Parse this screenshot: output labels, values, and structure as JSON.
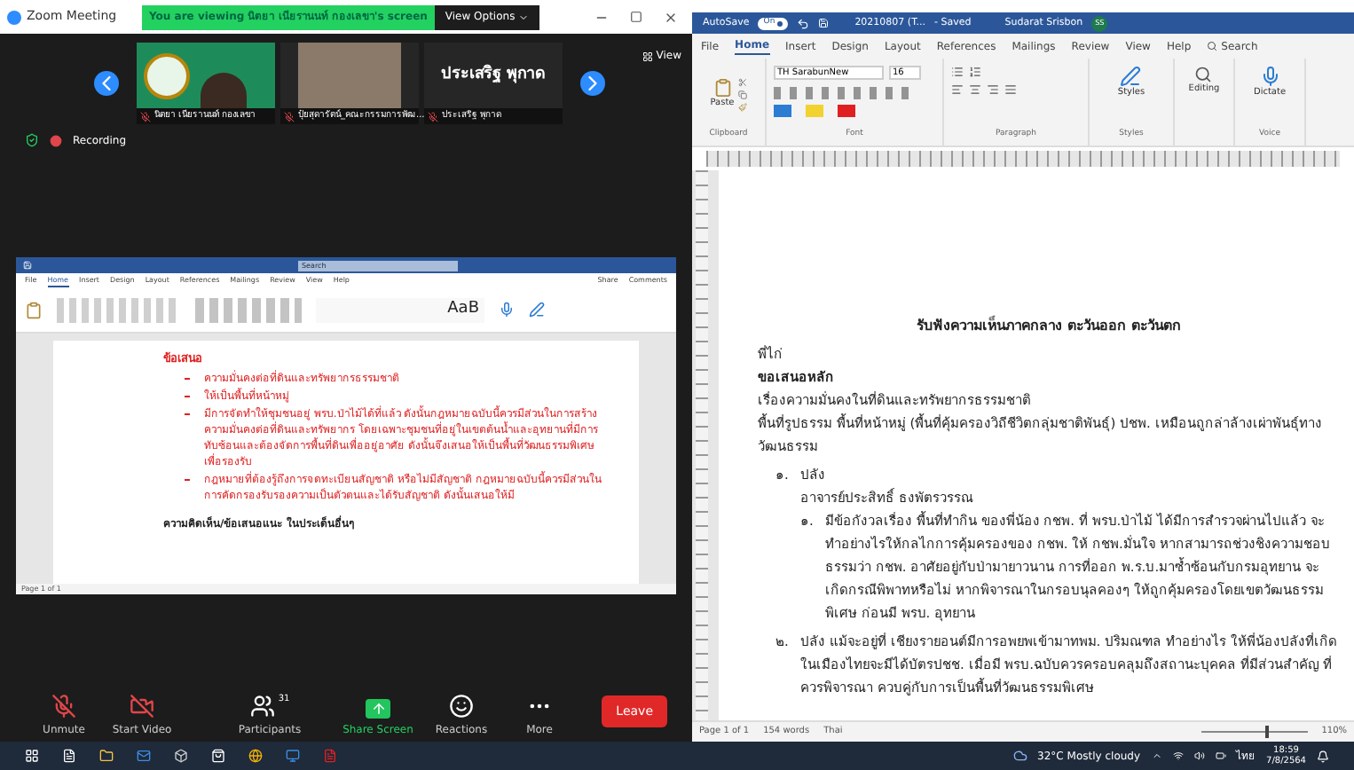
{
  "zoom": {
    "window_title": "Zoom Meeting",
    "banner": "You are viewing นิตยา เนียรานนท์ กองเลขา's screen",
    "view_options": "View Options",
    "view_button": "View",
    "recording": "Recording",
    "videos": [
      {
        "kind": "logo",
        "name": "นิตยา เนียรานนท์ กองเลขา"
      },
      {
        "kind": "camera",
        "name": "ปุ๋ยสุดารัตน์_คณะกรรมการพัฒ..."
      },
      {
        "kind": "name",
        "display": "ประเสริฐ  พุกาด",
        "name": "ประเสริฐ  พุกาด"
      }
    ],
    "shared_word": {
      "tabs": [
        {
          "label": "File",
          "selected": false
        },
        {
          "label": "Home",
          "selected": true
        },
        {
          "label": "Insert",
          "selected": false
        },
        {
          "label": "Design",
          "selected": false
        },
        {
          "label": "Layout",
          "selected": false
        },
        {
          "label": "References",
          "selected": false
        },
        {
          "label": "Mailings",
          "selected": false
        },
        {
          "label": "Review",
          "selected": false
        },
        {
          "label": "View",
          "selected": false
        },
        {
          "label": "Help",
          "selected": false
        }
      ],
      "search": "Search",
      "share": "Share",
      "comments": "Comments",
      "style_sample": "AaB",
      "heading": "ข้อเสนอ",
      "bullets": [
        "ความมั่นคงต่อที่ดินและทรัพยากรธรรมชาติ",
        "ให้เป็นพื้นที่หน้าหมู่",
        "มีการจัดทำให้ชุมชนอยู่ พรบ.ป่าไม้ได้ที่แล้ว ดังนั้นกฎหมายฉบับนี้ควรมีส่วนในการสร้างความมั่นคงต่อที่ดินและทรัพยากร โดยเฉพาะชุมชนที่อยู่ในเขตต้นน้ำและอุทยานที่มีการทับซ้อนและต้องจัดการพื้นที่ดินเพื่ออยู่อาศัย ดังนั้นจึงเสนอให้เป็นพื้นที่วัฒนธรรมพิเศษเพื่อรองรับ",
        "กฎหมายที่ต้องรู้ถึงการจดทะเบียนสัญชาติ หรือไม่มีสัญชาติ กฎหมายฉบับนี้ควรมีส่วนในการคัดกรองรับรองความเป็นตัวตนและได้รับสัญชาติ ดังนั้นเสนอให้มี"
      ],
      "closing": "ความคิดเห็น/ข้อเสนอแนะ ในประเด็นอื่นๆ",
      "page": "Page 1 of 1"
    },
    "controls": [
      {
        "kind": "mic",
        "label": "Unmute"
      },
      {
        "kind": "video",
        "label": "Start Video"
      },
      {
        "kind": "participants",
        "label": "Participants",
        "count": "31"
      },
      {
        "kind": "share",
        "label": "Share Screen"
      },
      {
        "kind": "reactions",
        "label": "Reactions"
      },
      {
        "kind": "more",
        "label": "More"
      }
    ],
    "leave": "Leave"
  },
  "word": {
    "autosave": "AutoSave",
    "autosave_state": "On",
    "doc_title": "20210807 (T...",
    "saved": "- Saved",
    "user": "Sudarat Srisbon",
    "initials": "SS",
    "tabs": [
      {
        "label": "File",
        "selected": false
      },
      {
        "label": "Home",
        "selected": true
      },
      {
        "label": "Insert",
        "selected": false
      },
      {
        "label": "Design",
        "selected": false
      },
      {
        "label": "Layout",
        "selected": false
      },
      {
        "label": "References",
        "selected": false
      },
      {
        "label": "Mailings",
        "selected": false
      },
      {
        "label": "Review",
        "selected": false
      },
      {
        "label": "View",
        "selected": false
      },
      {
        "label": "Help",
        "selected": false
      }
    ],
    "search": "Search",
    "font": "TH SarabunNew",
    "size": "16",
    "paste": "Paste",
    "styles": "Styles",
    "editing": "Editing",
    "dictate": "Dictate",
    "groups": [
      "Clipboard",
      "Font",
      "Paragraph",
      "Styles",
      "Voice"
    ],
    "lines": [
      {
        "kind": "title",
        "text": "รับฟังความเห็นภาคกลาง ตะวันออก ตะวันตก"
      },
      {
        "kind": "plain",
        "text": "พี่ไก่"
      },
      {
        "kind": "bold",
        "text": "ขอเสนอหลัก"
      },
      {
        "kind": "plain",
        "text": "เรื่องความมั่นคงในที่ดินและทรัพยากรธรรมชาติ"
      },
      {
        "kind": "plain",
        "text": "พื้นที่รูปธรรม  พื้นที่หน้าหมู่ (พื้นที่คุ้มครองวิถีชีวิตกลุ่มชาติพันธุ์) ปชพ. เหมือนถูกล่าล้างเผ่าพันธุ์ทางวัฒนธรรม"
      },
      {
        "kind": "item",
        "number": "๑.",
        "text": "ปลัง"
      },
      {
        "kind": "sub",
        "text": "อาจารย์ประสิทธิ์ ธงพัตรวรรณ"
      },
      {
        "kind": "subitem",
        "number": "๑.",
        "text": "มีข้อกังวลเรื่อง พื้นที่ทำกิน ของพี่น้อง กชพ. ที่ พรบ.ป่าไม้ ได้มีการสำรวจผ่านไปแล้ว จะทำอย่างไรให้กลไกการคุ้มครองของ กชพ. ให้ กชพ.มั่นใจ   หากสามารถช่วงชิงความชอบธรรมว่า กชพ. อาศัยอยู่กับป่ามายาวนาน การที่ออก พ.ร.บ.มาซ้ำซ้อนกับกรมอุทยาน จะเกิดกรณีพิพาทหรือไม่ หากพิจารณาในกรอบนุลคองๆ ให้ถูกคุ้มครองโดยเขตวัฒนธรรมพิเศษ ก่อนมี พรบ. อุทยาน"
      },
      {
        "kind": "item",
        "number": "๒.",
        "text": "ปลัง แม้จะอยู่ที่ เชียงรายอนต์มีการอพยพเข้ามาทพม. ปริมณฑล ทำอย่างไร ให้พี่น้องปลังที่เกิดในเมืองไทยจะมีได้บัตรปชช. เมื่อมี พรบ.ฉบับควรครอบคลุมถึงสถานะบุคคล ที่มีส่วนสำคัญ ที่ควรพิจารณา ควบคู่กับการเป็นพื้นที่วัฒนธรรมพิเศษ"
      }
    ],
    "status": {
      "page": "Page 1 of 1",
      "words": "154 words",
      "language": "Thai",
      "zoom": "110%"
    }
  },
  "taskbar": {
    "weather": "32°C  Mostly cloudy",
    "language": "ไทย",
    "time": "18:59",
    "date": "7/8/2564"
  }
}
